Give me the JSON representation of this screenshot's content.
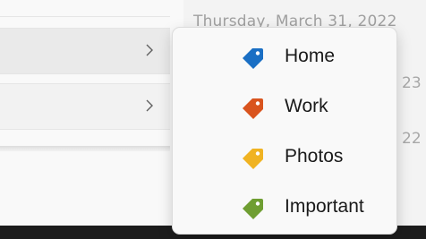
{
  "background": {
    "date_heading": "Thursday, March 31, 2022",
    "fragment_1": "23",
    "fragment_2": "22"
  },
  "context_menu": {
    "items": [
      {
        "label": "Home",
        "icon": "tag-icon",
        "color": "#1a6fc4"
      },
      {
        "label": "Work",
        "icon": "tag-icon",
        "color": "#d9541e"
      },
      {
        "label": "Photos",
        "icon": "tag-icon",
        "color": "#f0b322"
      },
      {
        "label": "Important",
        "icon": "tag-icon",
        "color": "#6f9e32"
      }
    ]
  }
}
